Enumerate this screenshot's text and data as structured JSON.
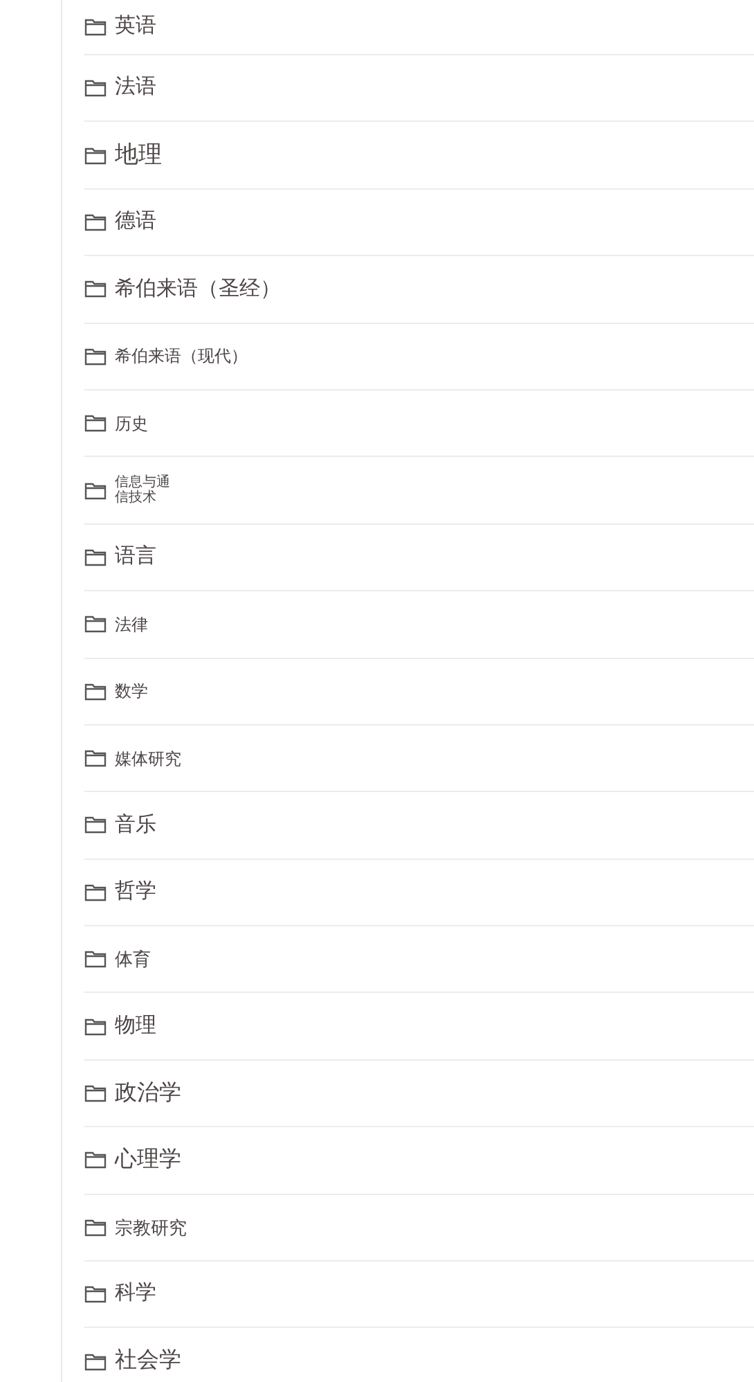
{
  "folders": [
    {
      "label": "英语"
    },
    {
      "label": "法语"
    },
    {
      "label": "地理"
    },
    {
      "label": "德语"
    },
    {
      "label": "希伯来语（圣经）"
    },
    {
      "label": "希伯来语（现代）"
    },
    {
      "label": "历史"
    },
    {
      "label": "信息与通信技术"
    },
    {
      "label": "语言"
    },
    {
      "label": "法律"
    },
    {
      "label": "数学"
    },
    {
      "label": "媒体研究"
    },
    {
      "label": "音乐"
    },
    {
      "label": "哲学"
    },
    {
      "label": "体育"
    },
    {
      "label": "物理"
    },
    {
      "label": "政治学"
    },
    {
      "label": "心理学"
    },
    {
      "label": "宗教研究"
    },
    {
      "label": "科学"
    },
    {
      "label": "社会学"
    }
  ]
}
